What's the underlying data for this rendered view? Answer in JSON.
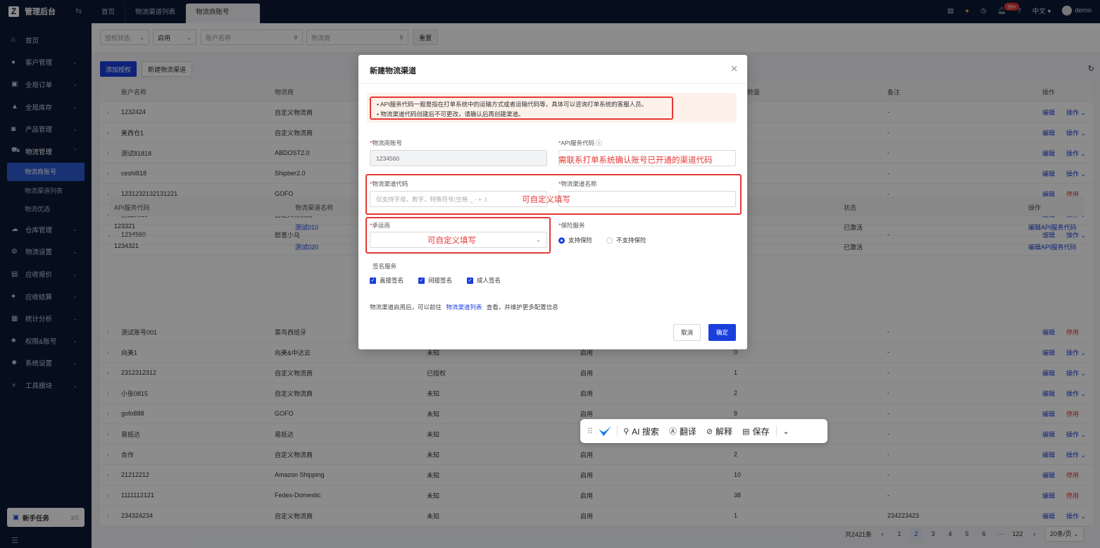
{
  "app": {
    "logo_glyph": "Z",
    "title": "管理后台"
  },
  "tabs": [
    {
      "label": "首页"
    },
    {
      "label": "物流渠道列表"
    },
    {
      "label": "物流商账号"
    }
  ],
  "topbar": {
    "badge": "99+",
    "language": "中文",
    "user": "demo"
  },
  "sidebar": {
    "items": [
      {
        "label": "首页",
        "icon": "home-icon"
      },
      {
        "label": "客户管理",
        "icon": "users-icon"
      },
      {
        "label": "全局订单",
        "icon": "order-icon"
      },
      {
        "label": "全局库存",
        "icon": "warehouse-icon"
      },
      {
        "label": "产品管理",
        "icon": "product-icon"
      },
      {
        "label": "物流管理",
        "icon": "truck-icon"
      }
    ],
    "subitems": [
      "物流商账号",
      "物流渠道列表",
      "物流优选"
    ],
    "items2": [
      {
        "label": "仓库管理"
      },
      {
        "label": "物流设置"
      },
      {
        "label": "应收报价"
      },
      {
        "label": "应收结算"
      },
      {
        "label": "统计分析"
      },
      {
        "label": "权限&账号"
      },
      {
        "label": "系统设置"
      },
      {
        "label": "工具模块"
      }
    ],
    "newbie": {
      "label": "新手任务",
      "count": "3/5"
    }
  },
  "filters": {
    "auth_status": "授权状态",
    "enabled": "启用",
    "account_placeholder": "账户名称",
    "carrier_placeholder": "物流商",
    "reset": "重置"
  },
  "toolbar": {
    "add_auth": "添加授权",
    "new_channel": "新建物流渠道"
  },
  "table": {
    "headers": [
      "账户名称",
      "物流商",
      "务数量",
      "备注",
      "操作"
    ],
    "rows": [
      {
        "name": "1232424",
        "carrier": "自定义物流商",
        "status": "",
        "enabled": "",
        "count": "",
        "note": "-",
        "op2": "操作"
      },
      {
        "name": "美西仓1",
        "carrier": "自定义物流商",
        "status": "",
        "enabled": "",
        "count": "",
        "note": "-",
        "op2": "操作"
      },
      {
        "name": "测试81818",
        "carrier": "ABDOST2.0",
        "status": "",
        "enabled": "",
        "count": "",
        "note": "-",
        "op2": "操作"
      },
      {
        "name": "ceshi818",
        "carrier": "Shipber2.0",
        "status": "",
        "enabled": "",
        "count": "",
        "note": "-",
        "op2": "操作"
      },
      {
        "name": "1231232132131221",
        "carrier": "GOFO",
        "status": "",
        "enabled": "",
        "count": "",
        "note": "-",
        "op2": "停用"
      },
      {
        "name": "测试0010",
        "carrier": "自定义物流商",
        "status": "",
        "enabled": "",
        "count": "",
        "note": "-",
        "op2": "操作"
      },
      {
        "name": "1234560",
        "carrier": "邮差小马",
        "status": "",
        "enabled": "",
        "count": "",
        "note": "-",
        "op2": "操作"
      }
    ],
    "rows2": [
      {
        "name": "测试账号001",
        "carrier": "菜鸟西班牙",
        "status": "",
        "enabled": "",
        "count": "",
        "note": "-",
        "op2": "停用"
      },
      {
        "name": "向美1",
        "carrier": "向美&中达云",
        "status": "未知",
        "enabled": "启用",
        "count": "0",
        "note": "-",
        "op2": "操作"
      },
      {
        "name": "2312312312",
        "carrier": "自定义物流商",
        "status": "已授权",
        "enabled": "启用",
        "count": "1",
        "note": "-",
        "op2": "操作"
      },
      {
        "name": "小张0815",
        "carrier": "自定义物流商",
        "status": "未知",
        "enabled": "启用",
        "count": "2",
        "note": "-",
        "op2": "操作"
      },
      {
        "name": "gofo888",
        "carrier": "GOFO",
        "status": "未知",
        "enabled": "启用",
        "count": "8",
        "note": "-",
        "op2": "停用"
      },
      {
        "name": "易抵达",
        "carrier": "易抵达",
        "status": "未知",
        "enabled": "启用",
        "count": "",
        "note": "-",
        "op2": "操作"
      },
      {
        "name": "合作",
        "carrier": "自定义物流商",
        "status": "未知",
        "enabled": "启用",
        "count": "2",
        "note": "-",
        "op2": "操作"
      },
      {
        "name": "21212212",
        "carrier": "Amazon Shipping",
        "status": "未知",
        "enabled": "启用",
        "count": "10",
        "note": "-",
        "op2": "停用"
      },
      {
        "name": "1111112121",
        "carrier": "Fedex-Domestic",
        "status": "未知",
        "enabled": "启用",
        "count": "38",
        "note": "-",
        "op2": "停用"
      },
      {
        "name": "234324234",
        "carrier": "自定义物流商",
        "status": "未知",
        "enabled": "启用",
        "count": "1",
        "note": "234223423",
        "op2": "操作"
      }
    ],
    "edit_label": "编辑"
  },
  "subtable": {
    "headers": [
      "API服务代码",
      "物流渠道名称",
      "状态",
      "操作"
    ],
    "rows": [
      {
        "code": "123321",
        "name": "测试010",
        "status": "已激活",
        "op": "编辑API服务代码"
      },
      {
        "code": "1234321",
        "name": "测试020",
        "status": "已激活",
        "op": "编辑API服务代码"
      }
    ]
  },
  "pager": {
    "total": "共2421条",
    "pages": [
      "1",
      "2",
      "3",
      "4",
      "5",
      "6",
      "···",
      "122"
    ],
    "size": "20条/页"
  },
  "modal": {
    "title": "新建物流渠道",
    "alert1": "API服务代码一般是指在打单系统中的运输方式或者运输代码等，具体可以咨询打单系统的客服人员。",
    "alert2": "物流渠道代码创建后不可更改，请确认后再创建渠道。",
    "carrier_account_label": "物流商账号",
    "carrier_account_value": "1234560",
    "api_code_label": "API服务代码",
    "api_code_note": "需联系打单系统确认账号已开通的渠道代码",
    "channel_code_label": "物流渠道代码",
    "channel_code_placeholder": "仅支持字母，数字，特殊符号(空格 _ - + .)",
    "channel_name_label": "物流渠道名称",
    "custom_note_1": "可自定义填写",
    "carrier_label": "承运商",
    "custom_note_2": "可自定义填写",
    "insurance_label": "保险服务",
    "insurance_yes": "支持保险",
    "insurance_no": "不支持保险",
    "signature_label": "签名服务",
    "sig1": "直接签名",
    "sig2": "间接签名",
    "sig3": "成人签名",
    "hint_pre": "物流渠道启用后，可以前往",
    "hint_link": "物流渠道列表",
    "hint_post": "查看，并维护更多配置信息",
    "cancel": "取消",
    "ok": "确定"
  },
  "aibar": {
    "search": "AI 搜索",
    "translate": "翻译",
    "explain": "解释",
    "save": "保存"
  }
}
